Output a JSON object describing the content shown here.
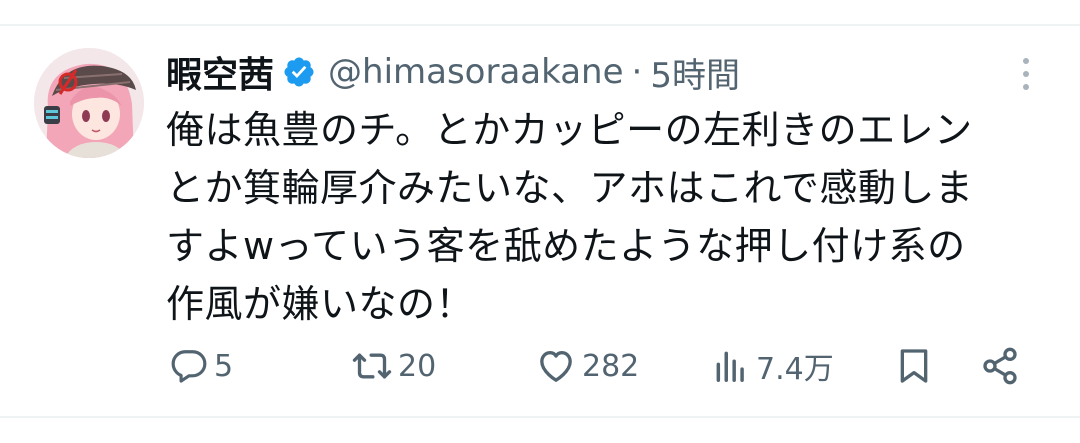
{
  "tweet": {
    "display_name": "暇空茜",
    "handle": "@himasoraakane",
    "separator": "·",
    "time": "5時間",
    "verified": true,
    "text_lines": [
      "俺は魚豊のチ。とかカッピーの左利きのエレン",
      "とか箕輪厚介みたいな、アホはこれで感動しま",
      "すよwっていう客を舐めたような押し付け系の",
      "作風が嫌いなの！"
    ]
  },
  "actions": {
    "reply_count": "5",
    "retweet_count": "20",
    "like_count": "282",
    "views_count": "7.4万"
  },
  "icons": {
    "verified": "verified-badge-icon",
    "more": "more-vertical-icon",
    "reply": "reply-icon",
    "retweet": "retweet-icon",
    "like": "heart-icon",
    "views": "views-icon",
    "bookmark": "bookmark-icon",
    "share": "share-icon"
  },
  "colors": {
    "text": "#0f1419",
    "secondary": "#536471",
    "verified": "#1d9bf0",
    "divider": "#eff3f4"
  }
}
